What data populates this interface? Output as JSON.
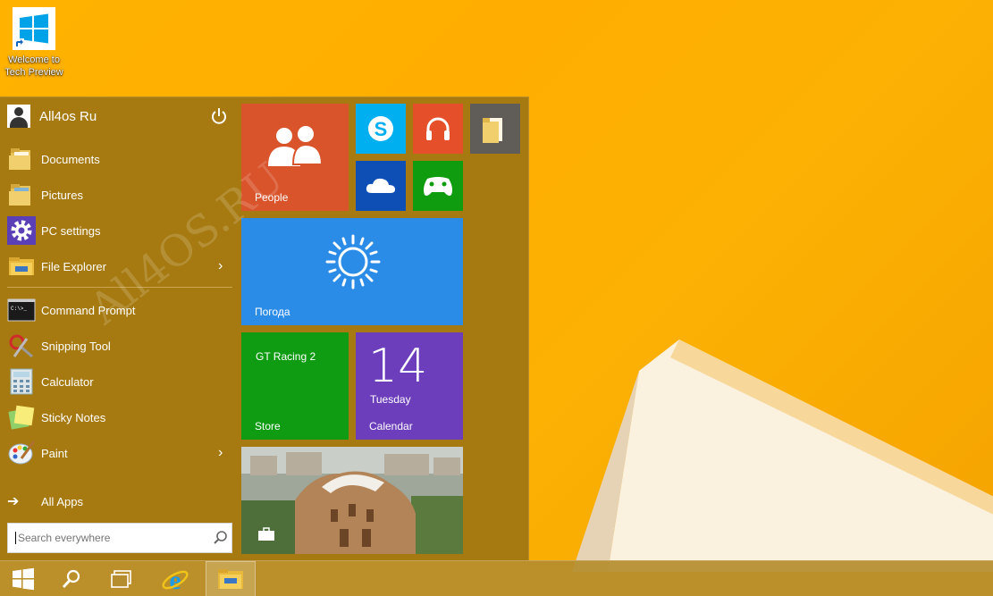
{
  "desktop": {
    "icon_label_line1": "Welcome to",
    "icon_label_line2": "Tech Preview",
    "icon_name": "windows-logo-icon"
  },
  "start_menu": {
    "user_name": "All4os Ru",
    "menu_items": [
      {
        "label": "Documents",
        "icon": "documents-folder-icon",
        "has_submenu": false
      },
      {
        "label": "Pictures",
        "icon": "pictures-folder-icon",
        "has_submenu": false
      },
      {
        "label": "PC settings",
        "icon": "gear-icon",
        "has_submenu": false
      },
      {
        "label": "File Explorer",
        "icon": "file-explorer-icon",
        "has_submenu": true
      }
    ],
    "app_items": [
      {
        "label": "Command Prompt",
        "icon": "command-prompt-icon",
        "has_submenu": false
      },
      {
        "label": "Snipping Tool",
        "icon": "snipping-tool-icon",
        "has_submenu": false
      },
      {
        "label": "Calculator",
        "icon": "calculator-icon",
        "has_submenu": false
      },
      {
        "label": "Sticky Notes",
        "icon": "sticky-notes-icon",
        "has_submenu": false
      },
      {
        "label": "Paint",
        "icon": "paint-icon",
        "has_submenu": true
      }
    ],
    "all_apps_label": "All Apps",
    "search_placeholder": "Search everywhere"
  },
  "tiles": {
    "people": "People",
    "weather": "Погода",
    "store_top": "GT Racing 2",
    "store": "Store",
    "calendar_day_number": "14",
    "calendar_weekday": "Tuesday",
    "calendar": "Calendar"
  },
  "watermark": "All4OS.RU",
  "colors": {
    "menu_bg": "#a67a10",
    "people": "#d9532b",
    "skype": "#00aff0",
    "music": "#e5502b",
    "onedrive": "#0e4fb5",
    "xbox": "#0f9c0f",
    "weather": "#2b8ce8",
    "store": "#0f9b12",
    "calendar": "#6c3ebc"
  },
  "taskbar": {
    "buttons": [
      "start-button",
      "search-button",
      "task-view-button",
      "internet-explorer-button",
      "file-explorer-button"
    ]
  }
}
